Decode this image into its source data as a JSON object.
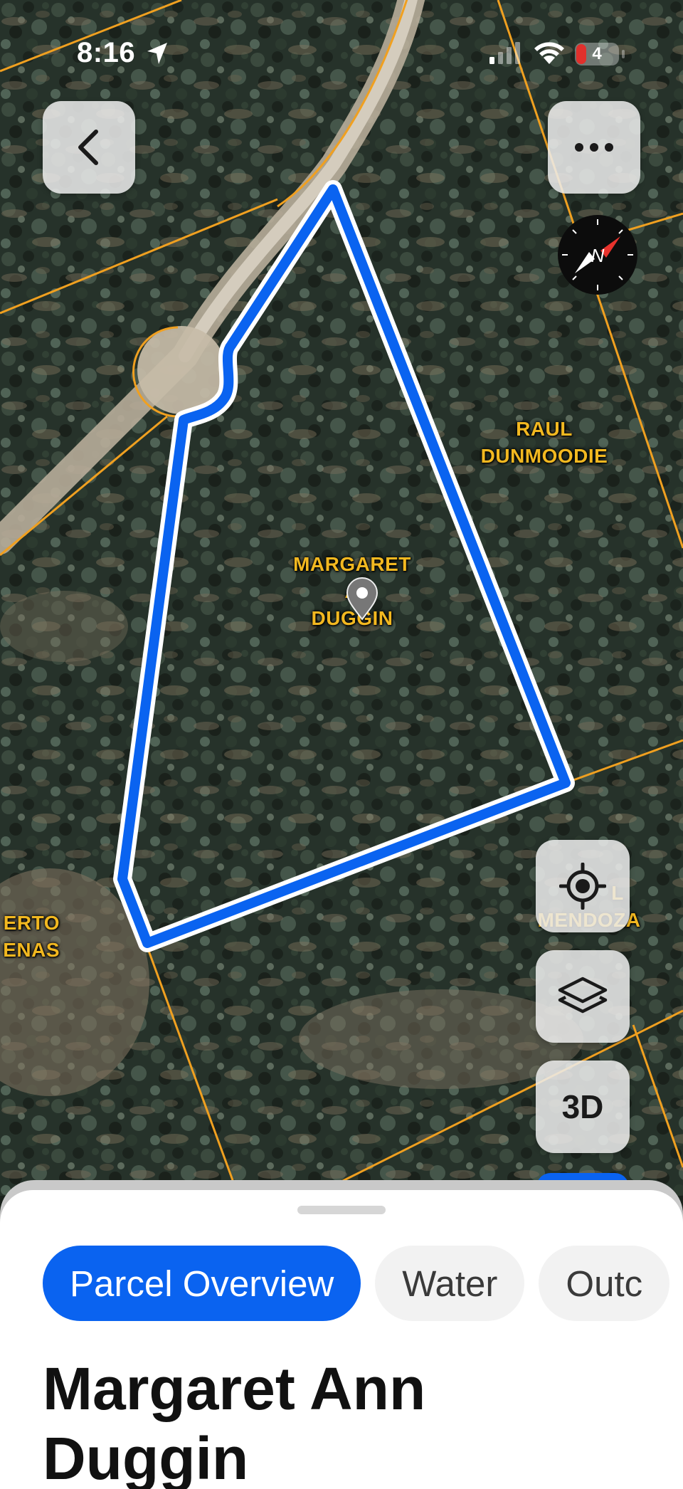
{
  "status_bar": {
    "time": "8:16",
    "battery": "4"
  },
  "map": {
    "parcel_labels": [
      {
        "id": "margaret",
        "lines": [
          "MARGARET",
          "A",
          "DUGGIN"
        ]
      },
      {
        "id": "raul",
        "lines": [
          "RAUL",
          "DUNMOODIE"
        ]
      },
      {
        "id": "mendoza",
        "lines": [
          "L",
          "MENDOZA"
        ]
      },
      {
        "id": "erto",
        "lines": [
          "ERTO",
          "ENAS"
        ]
      }
    ],
    "compass_letter": "N",
    "controls": {
      "three_d_label": "3D"
    }
  },
  "sheet": {
    "tabs": [
      {
        "label": "Parcel Overview",
        "active": true
      },
      {
        "label": "Water",
        "active": false
      },
      {
        "label": "Outc",
        "active": false
      }
    ],
    "title": "Margaret Ann Duggin"
  },
  "colors": {
    "accent": "#0a63f0",
    "parcel_line": "#f0a020",
    "label_text": "#f2b820"
  }
}
